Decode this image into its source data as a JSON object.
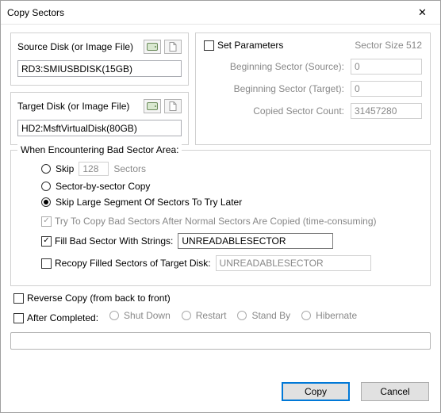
{
  "window": {
    "title": "Copy Sectors"
  },
  "source": {
    "label": "Source Disk (or Image File)",
    "value": "RD3:SMIUSBDISK(15GB)"
  },
  "target": {
    "label": "Target Disk (or Image File)",
    "value": "HD2:MsftVirtualDisk(80GB)"
  },
  "params": {
    "set_label": "Set Parameters",
    "sector_size_label": "Sector Size 512",
    "begin_src_label": "Beginning Sector (Source):",
    "begin_src_value": "0",
    "begin_tgt_label": "Beginning Sector (Target):",
    "begin_tgt_value": "0",
    "count_label": "Copied Sector Count:",
    "count_value": "31457280"
  },
  "bad": {
    "legend": "When Encountering Bad Sector Area:",
    "skip_label": "Skip",
    "skip_value": "128",
    "skip_unit": "Sectors",
    "sector_by_sector": "Sector-by-sector Copy",
    "skip_large": "Skip Large Segment Of Sectors To Try Later",
    "try_after": "Try To Copy Bad Sectors After Normal Sectors Are Copied (time-consuming)",
    "fill_label": "Fill Bad Sector With Strings:",
    "fill_value": "UNREADABLESECTOR",
    "recopy_label": "Recopy Filled Sectors of Target Disk:",
    "recopy_value": "UNREADABLESECTOR"
  },
  "reverse": {
    "label": "Reverse Copy (from back to front)"
  },
  "after": {
    "label": "After Completed:",
    "shutdown": "Shut Down",
    "restart": "Restart",
    "standby": "Stand By",
    "hibernate": "Hibernate"
  },
  "buttons": {
    "copy": "Copy",
    "cancel": "Cancel"
  }
}
